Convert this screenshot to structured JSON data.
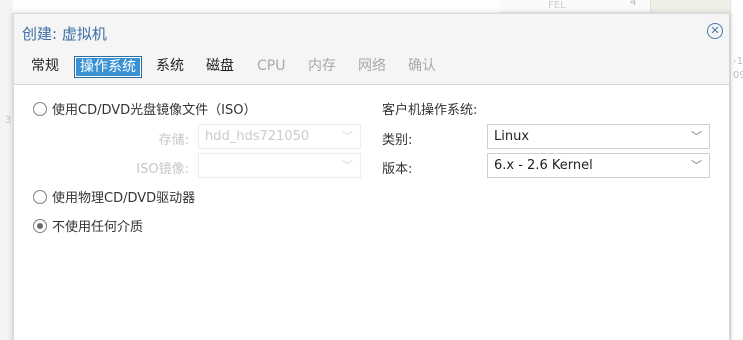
{
  "background": {
    "left_text": "3",
    "right_texts": [
      "-1",
      "09"
    ],
    "top_text_a": "FEL",
    "top_text_b": "4"
  },
  "dialog": {
    "title": "创建: 虚拟机",
    "close_icon": "close-icon"
  },
  "tabs": [
    {
      "label": "常规",
      "state": "normal"
    },
    {
      "label": "操作系统",
      "state": "active"
    },
    {
      "label": "系统",
      "state": "normal"
    },
    {
      "label": "磁盘",
      "state": "normal"
    },
    {
      "label": "CPU",
      "state": "disabled"
    },
    {
      "label": "内存",
      "state": "disabled"
    },
    {
      "label": "网络",
      "state": "disabled"
    },
    {
      "label": "确认",
      "state": "disabled"
    }
  ],
  "media": {
    "iso_option": {
      "label": "使用CD/DVD光盘镜像文件（ISO）",
      "checked": false
    },
    "storage": {
      "label": "存储:",
      "value": "hdd_hds721050"
    },
    "iso_image": {
      "label": "ISO镜像:",
      "value": ""
    },
    "physical_option": {
      "label": "使用物理CD/DVD驱动器",
      "checked": false
    },
    "none_option": {
      "label": "不使用任何介质",
      "checked": true
    }
  },
  "guest_os": {
    "title": "客户机操作系统:",
    "type_label": "类别:",
    "type_value": "Linux",
    "version_label": "版本:",
    "version_value": "6.x - 2.6 Kernel"
  },
  "colors": {
    "accent": "#3892d4",
    "title": "#3d6fa8"
  }
}
